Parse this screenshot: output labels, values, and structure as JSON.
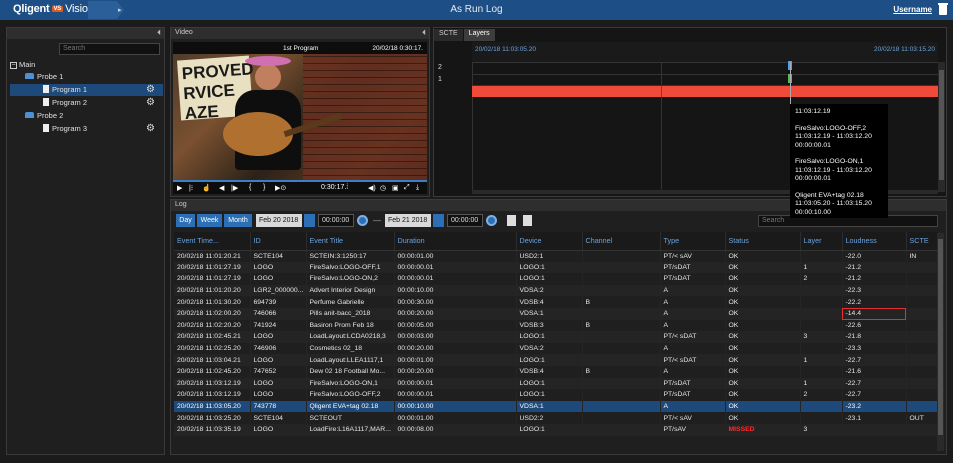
{
  "header": {
    "logo_text": "Qligent",
    "logo_badge": "VS",
    "logo_suffix": "Vision",
    "title": "As Run Log",
    "username": "Username",
    "colors": {
      "bar": "#1d4f86",
      "accent": "#2c6fb5",
      "badge": "#e05a1d"
    }
  },
  "tree": {
    "search_placeholder": "Search",
    "nodes": [
      {
        "label": "Main",
        "kind": "root"
      },
      {
        "label": "Probe 1",
        "kind": "probe"
      },
      {
        "label": "Program 1",
        "kind": "program",
        "selected": true
      },
      {
        "label": "Program 2",
        "kind": "program"
      },
      {
        "label": "Probe 2",
        "kind": "probe"
      },
      {
        "label": "Program 3",
        "kind": "program"
      }
    ]
  },
  "video": {
    "panel_title": "Video",
    "program_label": "1st Program",
    "date_label": "20/02/18",
    "time_short": "0:30:17.",
    "time_controls": "0:30:17.⁞",
    "sign_text": "PROVED\nRVICE\nAZE"
  },
  "timeline": {
    "tabs": [
      "SCTE",
      "Layers"
    ],
    "active_tab": "Layers",
    "time_start": "20/02/18 11:03:05.20",
    "time_end": "20/02/18 11:03:15.20",
    "layers": [
      "2",
      "1"
    ],
    "tooltip": [
      "11:03:12.19",
      "FireSalvo:LOGO-OFF,2\n11:03:12.19 - 11:03:12.20\n00:00:00.01",
      "FireSalvo:LOGO-ON,1\n11:03:12.19 - 11:03:12.20\n00:00:00.01",
      "Qligent EVA+tag 02.18\n11:03:05.20 - 11:03:15.20\n00:00:10.00"
    ]
  },
  "log": {
    "panel_title": "Log",
    "buttons": {
      "day": "Day",
      "week": "Week",
      "month": "Month"
    },
    "date_from": "Feb 20 2018",
    "time_from": "00:00:00",
    "date_to": "Feb 21 2018",
    "time_to": "00:00:00",
    "separator": "—",
    "search_placeholder": "Search",
    "columns": [
      "Event Time...",
      "ID",
      "Event Title",
      "Duration",
      "Device",
      "Channel",
      "Type",
      "Status",
      "Layer",
      "Loudness",
      "SCTE"
    ],
    "rows": [
      [
        "20/02/18 11:01:20.21",
        "SCTE104",
        "SCTEIN:3:1250:17",
        "00:00:01.00",
        "USD2:1",
        "",
        "PT/< sAV",
        "OK",
        "",
        "-22.0",
        "IN"
      ],
      [
        "20/02/18 11:01:27.19",
        "LOGO",
        "FireSalvo:LOGO-OFF,1",
        "00:00:00.01",
        "LOGO:1",
        "",
        "PT/sDAT",
        "OK",
        "1",
        "-21.2",
        ""
      ],
      [
        "20/02/18 11:01:27.19",
        "LOGO",
        "FireSalvo:LOGO-ON,2",
        "00:00:00.01",
        "LOGO:1",
        "",
        "PT/sDAT",
        "OK",
        "2",
        "-21.2",
        ""
      ],
      [
        "20/02/18 11:01:20.20",
        "LGR2_000000...",
        "Advert Interior Design",
        "00:00:10.00",
        "VDSA:2",
        "",
        "A",
        "OK",
        "",
        "-22.3",
        ""
      ],
      [
        "20/02/18 11:01:30.20",
        "694739",
        "Perfume  Gabrielle",
        "00:00:30.00",
        "VDSB:4",
        "B",
        "A",
        "OK",
        "",
        "-22.2",
        ""
      ],
      [
        "20/02/18 11:02:00.20",
        "746066",
        "Pills anit-bacc_2018",
        "00:00:20.00",
        "VDSA:1",
        "",
        "A",
        "OK",
        "",
        "-14.4",
        ""
      ],
      [
        "20/02/18 11:02:20.20",
        "741924",
        "Basiron  Prom Feb 18",
        "00:00:05.00",
        "VDSB:3",
        "B",
        "A",
        "OK",
        "",
        "-22.6",
        ""
      ],
      [
        "20/02/18 11:02:45.21",
        "LOGO",
        "LoadLayout:LCDA0218,3",
        "00:00:03.00",
        "LOGO:1",
        "",
        "PT/< sDAT",
        "OK",
        "3",
        "-21.8",
        ""
      ],
      [
        "20/02/18 11:02:25.20",
        "746906",
        "Cosmetics 02_18",
        "00:00:20.00",
        "VDSA:2",
        "",
        "A",
        "OK",
        "",
        "-23.3",
        ""
      ],
      [
        "20/02/18 11:03:04.21",
        "LOGO",
        "LoadLayout:LLEA1117,1",
        "00:00:01.00",
        "LOGO:1",
        "",
        "PT/< sDAT",
        "OK",
        "1",
        "-22.7",
        ""
      ],
      [
        "20/02/18 11:02:45.20",
        "747652",
        "Dew 02 18 Football Mo...",
        "00:00:20.00",
        "VDSB:4",
        "B",
        "A",
        "OK",
        "",
        "-21.6",
        ""
      ],
      [
        "20/02/18 11:03:12.19",
        "LOGO",
        "FireSalvo:LOGO-ON,1",
        "00:00:00.01",
        "LOGO:1",
        "",
        "PT/sDAT",
        "OK",
        "1",
        "-22.7",
        ""
      ],
      [
        "20/02/18 11:03:12.19",
        "LOGO",
        "FireSalvo:LOGO-OFF,2",
        "00:00:00.01",
        "LOGO:1",
        "",
        "PT/sDAT",
        "OK",
        "2",
        "-22.7",
        ""
      ],
      [
        "20/02/18 11:03:05.20",
        "743778",
        "Qligent EVA+tag 02.18",
        "00:00:10.00",
        "VDSA:1",
        "",
        "A",
        "OK",
        "",
        "-23.2",
        ""
      ],
      [
        "20/02/18 11:03:25.20",
        "SCTE104",
        "SCTEOUT",
        "00:00:01.00",
        "USD2:2",
        "",
        "PT/< sAV",
        "OK",
        "",
        "-23.1",
        "OUT"
      ],
      [
        "20/02/18 11:03:35.19",
        "LOGO",
        "LoadFire:L16A1117,MAR...",
        "00:00:08.00",
        "LOGO:1",
        "",
        "PT/sAV",
        "MISSED",
        "3",
        "",
        ""
      ]
    ],
    "selected_row": 13,
    "highlighted_cell": [
      5,
      9
    ],
    "status_colors": {
      "MISSED": "#ff2a2a"
    }
  }
}
